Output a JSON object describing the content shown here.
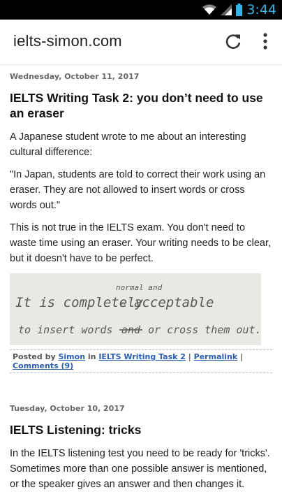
{
  "status_bar": {
    "time": "3:44"
  },
  "toolbar": {
    "url": "ielts-simon.com"
  },
  "posts": [
    {
      "date": "Wednesday, October 11, 2017",
      "title": "IELTS Writing Task 2: you don’t need to use an eraser",
      "paragraphs": [
        "A Japanese student wrote to me about an interesting cultural difference:",
        "\"In Japan, students are told to correct their work using an eraser. They are not allowed to insert words or cross words out.\"",
        "This is not true in the IELTS exam. You don't need to waste time using an eraser. Your writing needs to be clear, but it doesn't have to be perfect."
      ],
      "image_handwriting": {
        "line1_a": "It is completely",
        "line1_insert": "normal and",
        "line1_b": "acceptable",
        "line2_a": "to insert words",
        "line2_crossed": "and",
        "line2_b": "or cross them out."
      },
      "footer": {
        "posted_by": "Posted by",
        "author": "Simon",
        "in": "in",
        "category": "IELTS Writing Task 2",
        "sep1": "|",
        "permalink": "Permalink",
        "sep2": "|",
        "comments": "Comments (9)"
      }
    },
    {
      "date": "Tuesday, October 10, 2017",
      "title": "IELTS Listening: tricks",
      "paragraphs": [
        "In the IELTS listening test you need to be ready for 'tricks'. Sometimes more than one possible answer is mentioned, or the speaker gives an answer and then changes it."
      ]
    }
  ]
}
